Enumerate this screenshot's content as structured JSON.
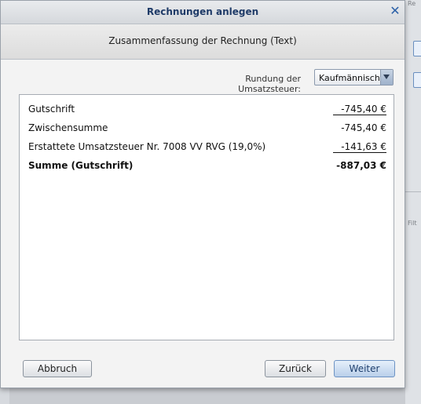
{
  "dialog": {
    "title": "Rechnungen anlegen",
    "close_icon": "close-icon",
    "subtitle": "Zusammenfassung der Rechnung (Text)"
  },
  "rounding": {
    "label": "Rundung der Umsatzsteuer:",
    "selected": "Kaufmännisch"
  },
  "summary": {
    "rows": [
      {
        "label": "Gutschrift",
        "value": "-745,40 €"
      },
      {
        "label": "Zwischensumme",
        "value": "-745,40 €"
      },
      {
        "label": "Erstattete Umsatzsteuer Nr. 7008 VV RVG (19,0%)",
        "value": "-141,63 €"
      },
      {
        "label": "Summe (Gutschrift)",
        "value": "-887,03 €"
      }
    ]
  },
  "buttons": {
    "cancel": "Abbruch",
    "back": "Zurück",
    "next": "Weiter"
  },
  "background": {
    "left_snippet": "os",
    "right_top_snippet": "Re",
    "right_filter_snippet": "Filt"
  }
}
